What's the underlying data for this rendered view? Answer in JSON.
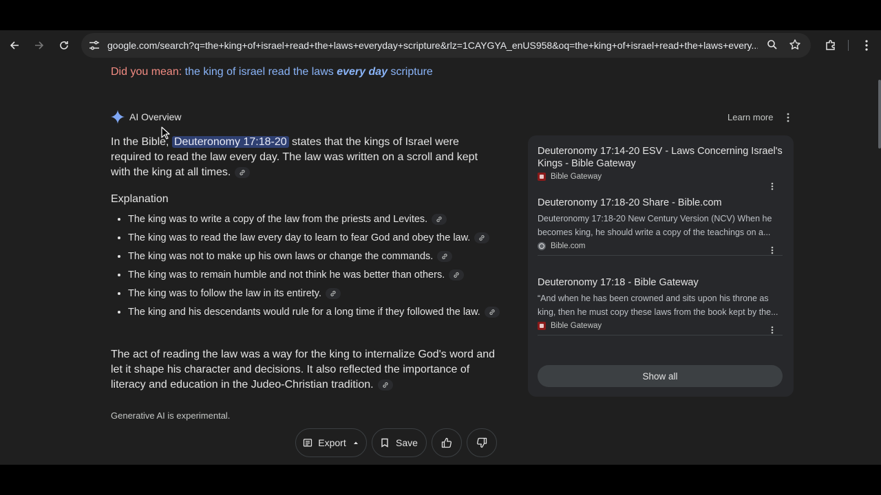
{
  "browser": {
    "url": "google.com/search?q=the+king+of+israel+read+the+laws+everyday+scripture&rlz=1CAYGYA_enUS958&oq=the+king+of+israel+read+the+laws+every..."
  },
  "did_you_mean": {
    "label": "Did you mean:",
    "part1": "the king of israel read the laws ",
    "bold": "every day",
    "part2": " scripture"
  },
  "ai_overview": {
    "title": "AI Overview",
    "learn_more": "Learn more",
    "intro_pre": "In the Bible, ",
    "intro_highlight": "Deuteronomy 17:18-20",
    "intro_post": " states that the kings of Israel were required to read the law every day. The law was written on a scroll and kept with the king at all times.",
    "explanation_heading": "Explanation",
    "bullets": [
      "The king was to write a copy of the law from the priests and Levites.",
      "The king was to read the law every day to learn to fear God and obey the law.",
      "The king was not to make up his own laws or change the commands.",
      "The king was to remain humble and not think he was better than others.",
      "The king was to follow the law in its entirety.",
      "The king and his descendants would rule for a long time if they followed the law."
    ],
    "conclusion": "The act of reading the law was a way for the king to internalize God's word and let it shape his character and decisions. It also reflected the importance of literacy and education in the Judeo-Christian tradition.",
    "disclaimer": "Generative AI is experimental.",
    "actions": {
      "export": "Export",
      "save": "Save"
    }
  },
  "sources": {
    "cards": [
      {
        "title": "Deuteronomy 17:14-20 ESV - Laws Concerning Israel's Kings - Bible Gateway",
        "snippet": "",
        "source": "Bible Gateway"
      },
      {
        "title": "Deuteronomy 17:18-20 Share - Bible.com",
        "snippet": "Deuteronomy 17:18-20 New Century Version (NCV) When he becomes king, he should write a copy of the teachings on a...",
        "source": "Bible.com"
      },
      {
        "title": "Deuteronomy 17:18 - Bible Gateway",
        "snippet": "“And when he has been crowned and sits upon his throne as king, then he must copy these laws from the book kept by the...",
        "source": "Bible Gateway"
      }
    ],
    "show_all": "Show all"
  },
  "colors": {
    "link": "#8ab4f8",
    "did_you_mean": "#f28b82",
    "highlight": "#2f4072",
    "panel_bg": "#27282b",
    "page_bg": "#1f1f1f"
  }
}
